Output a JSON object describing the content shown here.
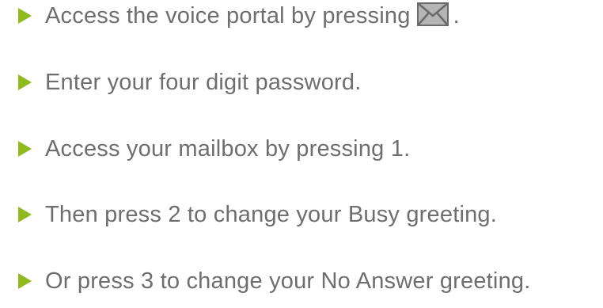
{
  "steps": [
    {
      "text": "Access the voice portal by pressing",
      "icon": "envelope-icon",
      "suffix": "."
    },
    {
      "text": "Enter your four digit password."
    },
    {
      "text": "Access your mailbox by pressing 1."
    },
    {
      "text": "Then press 2 to change your Busy greeting."
    },
    {
      "text": "Or press 3 to change your No Answer greeting."
    }
  ],
  "colors": {
    "bullet": "#8fba1f",
    "text": "#6e6e6e",
    "icon_fill": "#b5b5b5",
    "icon_stroke": "#6a6a6a"
  }
}
